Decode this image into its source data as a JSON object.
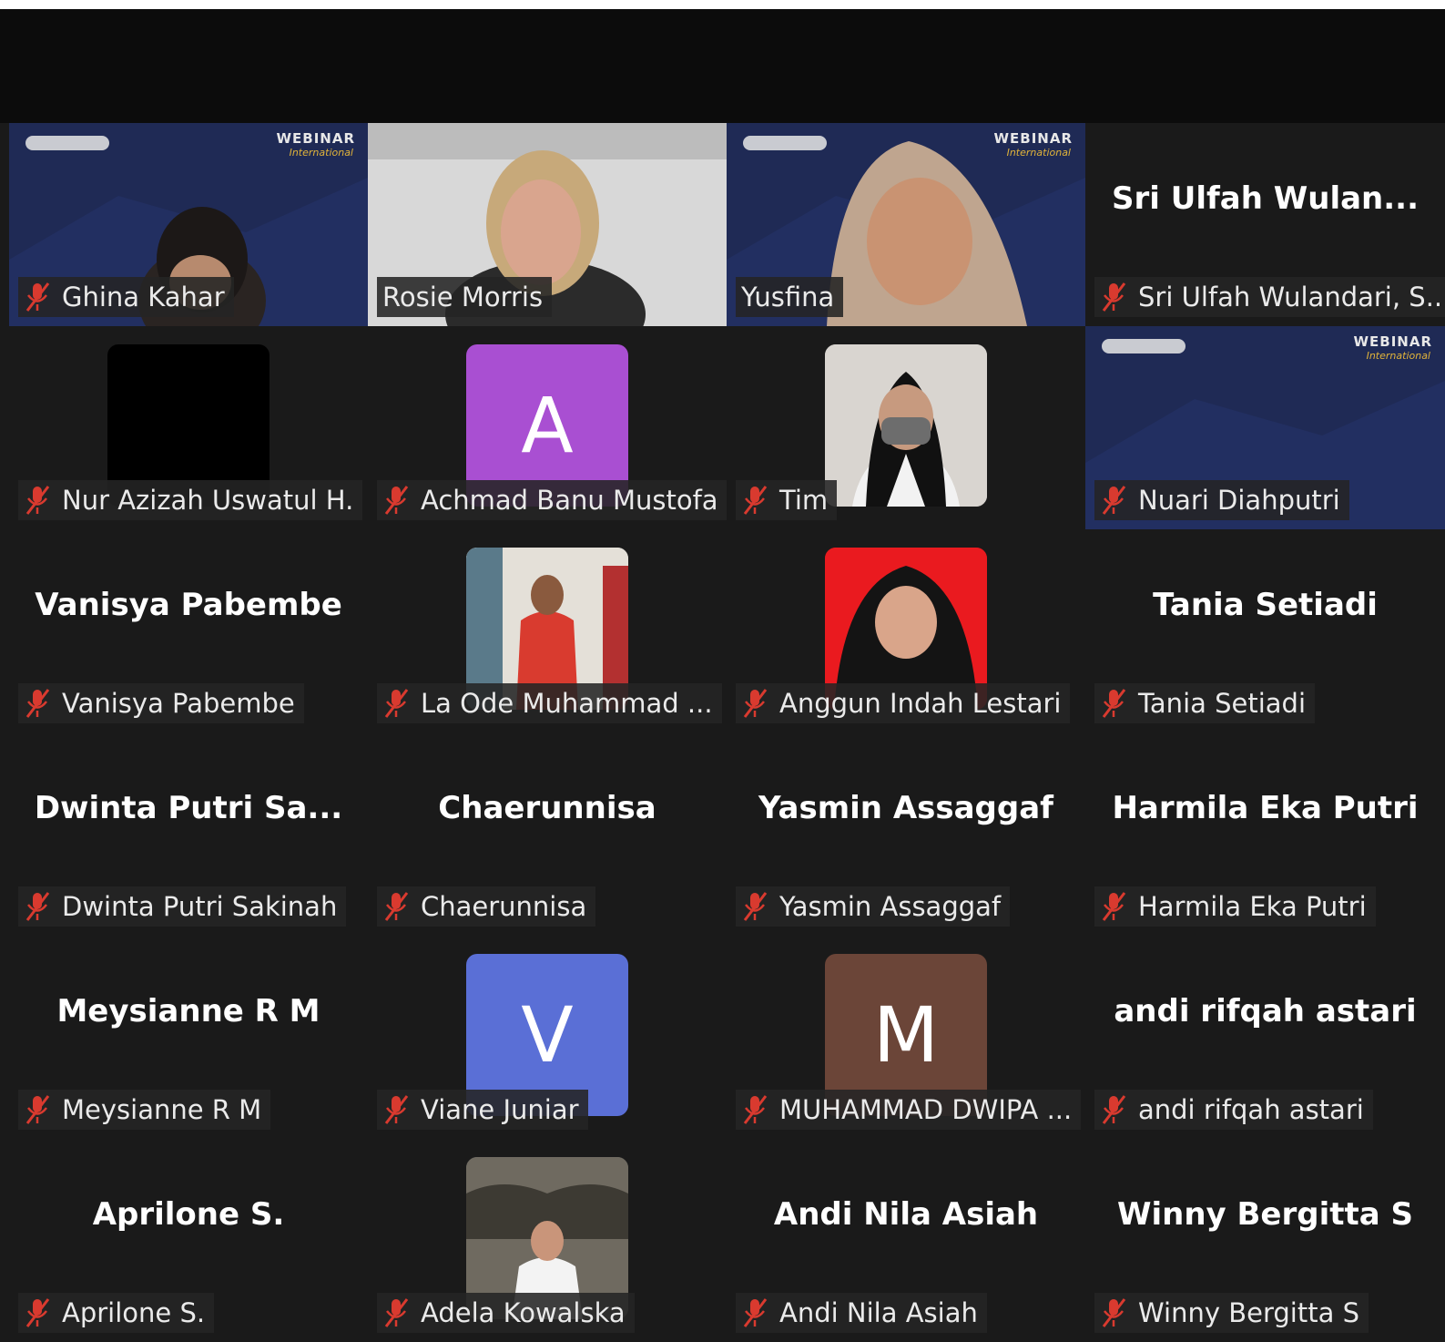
{
  "colors": {
    "background": "#1a1a1a",
    "active_speaker": "#25c46a",
    "mic_muted": "#d93a2f"
  },
  "tiles": [
    {
      "big_name": "",
      "label": "Ghina Kahar"
    },
    {
      "big_name": "",
      "label": "Rosie Morris"
    },
    {
      "big_name": "",
      "label": "Yusfina"
    },
    {
      "big_name": "Sri  Ulfah  Wulan...",
      "label": "Sri Ulfah Wulandari, S..."
    },
    {
      "big_name": "",
      "label": "Nur Azizah Uswatul H."
    },
    {
      "big_name": "",
      "avatar_letter": "A",
      "avatar_color": "#a94fd2",
      "label": "Achmad Banu Mustofa"
    },
    {
      "big_name": "",
      "label": "Tim"
    },
    {
      "big_name": "",
      "label": "Nuari Diahputri"
    },
    {
      "big_name": "Vanisya Pabembe",
      "label": "Vanisya Pabembe"
    },
    {
      "big_name": "",
      "label": "La Ode Muhammad ..."
    },
    {
      "big_name": "",
      "label": "Anggun Indah Lestari"
    },
    {
      "big_name": "Tania Setiadi",
      "label": "Tania Setiadi"
    },
    {
      "big_name": "Dwinta  Putri  Sa...",
      "label": "Dwinta Putri Sakinah"
    },
    {
      "big_name": "Chaerunnisa",
      "label": "Chaerunnisa"
    },
    {
      "big_name": "Yasmin Assaggaf",
      "label": "Yasmin Assaggaf"
    },
    {
      "big_name": "Harmila Eka Putri",
      "label": "Harmila Eka Putri"
    },
    {
      "big_name": "Meysianne R M",
      "label": "Meysianne R M"
    },
    {
      "big_name": "",
      "avatar_letter": "V",
      "avatar_color": "#5a6fd6",
      "label": "Viane Juniar"
    },
    {
      "big_name": "",
      "avatar_letter": "M",
      "avatar_color": "#6b4538",
      "label": "MUHAMMAD DWIPA ..."
    },
    {
      "big_name": "andi rifqah astari",
      "label": "andi rifqah astari"
    },
    {
      "big_name": "Aprilone S.",
      "label": "Aprilone S."
    },
    {
      "big_name": "",
      "label": "Adela Kowalska"
    },
    {
      "big_name": "Andi Nila Asiah",
      "label": "Andi Nila Asiah"
    },
    {
      "big_name": "Winny Bergitta S",
      "label": "Winny Bergitta S"
    }
  ],
  "webinar_banner": {
    "title": "WEBINAR",
    "subtitle": "International"
  }
}
